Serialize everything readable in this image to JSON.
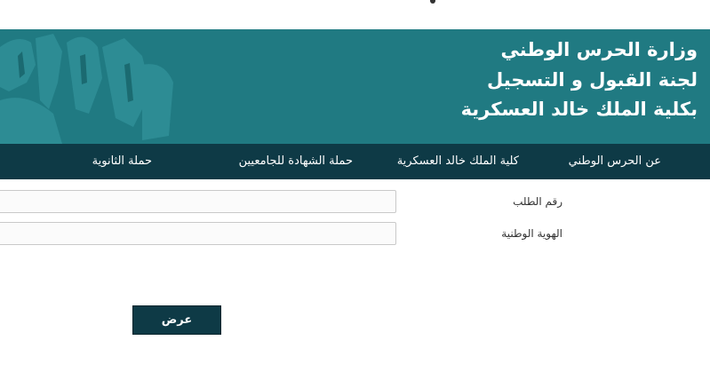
{
  "header": {
    "line1": "وزارة الحرس الوطني",
    "line2": "لجنة القبول و التسجيل",
    "line3": "بكلية الملك خالد العسكرية"
  },
  "nav": {
    "items": [
      {
        "label": "عن الحرس الوطني"
      },
      {
        "label": "كلية الملك خالد العسكرية"
      },
      {
        "label": "حملة الشهادة للجامعيين"
      },
      {
        "label": "حملة الثانوية"
      }
    ]
  },
  "form": {
    "application_number_label": "رقم الطلب",
    "application_number_value": "",
    "national_id_label": "الهوية الوطنية",
    "national_id_value": "",
    "submit_label": "عرض"
  },
  "colors": {
    "banner": "#207a82",
    "nav": "#0e3a46",
    "button": "#0e3a46"
  },
  "icons": {
    "banner_art": "soldiers-emblem-graphic"
  }
}
